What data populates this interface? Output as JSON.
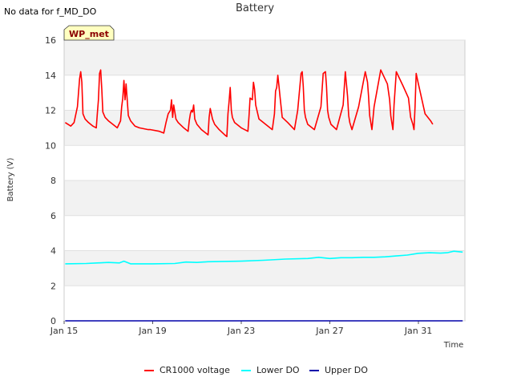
{
  "header": {
    "nodata_text": "No data for f_MD_DO"
  },
  "badge": {
    "label": "WP_met",
    "fill": "#ffffc0",
    "text_color": "#8b0000"
  },
  "chart_data": {
    "type": "line",
    "title": "Battery",
    "xlabel": "Time",
    "ylabel": "Battery (V)",
    "x_ticks": [
      "Jan 15",
      "Jan 19",
      "Jan 23",
      "Jan 27",
      "Jan 31"
    ],
    "x_tick_days": [
      15,
      19,
      23,
      27,
      31
    ],
    "xlim_days": [
      15,
      33.1
    ],
    "ylim": [
      0,
      16
    ],
    "y_ticks": [
      0,
      2,
      4,
      6,
      8,
      10,
      12,
      14,
      16
    ],
    "grid": true,
    "legend_position": "bottom",
    "series": [
      {
        "name": "CR1000 voltage",
        "color": "#ff0000",
        "x_days": [
          15.05,
          15.3,
          15.45,
          15.6,
          15.7,
          15.75,
          15.8,
          15.85,
          15.95,
          16.1,
          16.3,
          16.45,
          16.5,
          16.55,
          16.6,
          16.65,
          16.7,
          16.75,
          16.85,
          17.0,
          17.2,
          17.4,
          17.55,
          17.6,
          17.65,
          17.7,
          17.75,
          17.8,
          17.9,
          18.0,
          18.2,
          18.4,
          18.8,
          18.9,
          19.3,
          19.5,
          19.6,
          19.7,
          19.8,
          19.85,
          19.9,
          19.95,
          20.0,
          20.05,
          20.15,
          20.4,
          20.6,
          20.65,
          20.7,
          20.75,
          20.8,
          20.85,
          20.9,
          21.0,
          21.2,
          21.5,
          21.55,
          21.6,
          21.65,
          21.7,
          21.8,
          22.0,
          22.25,
          22.35,
          22.4,
          22.45,
          22.5,
          22.55,
          22.6,
          22.7,
          23.0,
          23.3,
          23.35,
          23.4,
          23.5,
          23.55,
          23.6,
          23.65,
          23.8,
          24.1,
          24.4,
          24.5,
          24.55,
          24.6,
          24.65,
          24.7,
          24.75,
          24.85,
          25.1,
          25.4,
          25.55,
          25.7,
          25.75,
          25.8,
          25.85,
          25.9,
          26.0,
          26.3,
          26.6,
          26.7,
          26.8,
          26.85,
          26.9,
          26.95,
          27.05,
          27.3,
          27.6,
          27.7,
          27.75,
          27.8,
          27.85,
          27.9,
          28.0,
          28.3,
          28.6,
          28.7,
          28.75,
          28.8,
          28.85,
          28.9,
          29.0,
          29.3,
          29.6,
          29.7,
          29.75,
          29.8,
          29.85,
          29.9,
          30.0,
          30.3,
          30.55,
          30.65,
          30.75,
          30.8,
          30.85,
          30.9,
          31.0,
          31.3,
          31.55,
          31.65,
          31.75,
          31.8,
          31.85,
          31.9,
          32.0,
          32.15
        ],
        "y": [
          11.3,
          11.1,
          11.3,
          12.2,
          13.8,
          14.2,
          13.6,
          11.8,
          11.5,
          11.3,
          11.1,
          11.0,
          11.8,
          12.6,
          14.1,
          14.3,
          13.2,
          11.9,
          11.6,
          11.4,
          11.2,
          11.0,
          11.4,
          12.2,
          12.7,
          13.7,
          12.6,
          13.5,
          11.7,
          11.4,
          11.1,
          11.0,
          10.9,
          10.9,
          10.8,
          10.7,
          11.3,
          11.8,
          12.0,
          12.6,
          11.6,
          12.3,
          11.9,
          11.5,
          11.3,
          11.0,
          10.8,
          11.4,
          11.8,
          12.0,
          11.9,
          12.3,
          11.5,
          11.2,
          10.9,
          10.6,
          11.6,
          12.1,
          11.8,
          11.5,
          11.2,
          10.9,
          10.6,
          10.5,
          11.8,
          12.5,
          13.3,
          12.0,
          11.6,
          11.3,
          11.0,
          10.8,
          11.7,
          12.7,
          12.6,
          13.6,
          13.2,
          12.3,
          11.5,
          11.2,
          10.9,
          11.8,
          13.1,
          13.3,
          14.0,
          13.4,
          12.8,
          11.6,
          11.3,
          10.9,
          12.0,
          14.1,
          14.2,
          13.4,
          12.0,
          11.6,
          11.2,
          10.9,
          12.2,
          14.1,
          14.2,
          13.4,
          12.0,
          11.6,
          11.2,
          10.9,
          12.3,
          14.2,
          13.5,
          12.8,
          11.7,
          11.3,
          10.9,
          12.2,
          14.2,
          13.6,
          12.8,
          11.7,
          11.3,
          10.9,
          12.2,
          14.3,
          13.5,
          12.6,
          11.7,
          11.3,
          10.9,
          12.3,
          14.2,
          13.4,
          12.7,
          11.6,
          11.2,
          10.9,
          12.2,
          14.1,
          13.5,
          11.8,
          11.4,
          11.2
        ]
      },
      {
        "name": "Lower DO",
        "color": "#00ffff",
        "x_days": [
          15.05,
          16.0,
          16.5,
          17.0,
          17.5,
          17.7,
          18.0,
          19.0,
          20.0,
          20.5,
          21.0,
          21.5,
          22.0,
          23.0,
          24.0,
          25.0,
          26.0,
          26.5,
          27.0,
          27.5,
          28.0,
          28.5,
          29.0,
          29.5,
          30.0,
          30.5,
          31.0,
          31.5,
          32.0,
          32.3,
          32.6,
          33.0
        ],
        "y": [
          3.25,
          3.27,
          3.3,
          3.33,
          3.3,
          3.4,
          3.25,
          3.25,
          3.27,
          3.35,
          3.33,
          3.37,
          3.38,
          3.4,
          3.45,
          3.52,
          3.55,
          3.62,
          3.55,
          3.6,
          3.6,
          3.62,
          3.62,
          3.65,
          3.7,
          3.75,
          3.85,
          3.88,
          3.86,
          3.88,
          3.97,
          3.92
        ]
      },
      {
        "name": "Upper DO",
        "color": "#0000aa",
        "x_days": [
          15.05,
          33.0
        ],
        "y": [
          0.0,
          0.0
        ]
      }
    ]
  }
}
